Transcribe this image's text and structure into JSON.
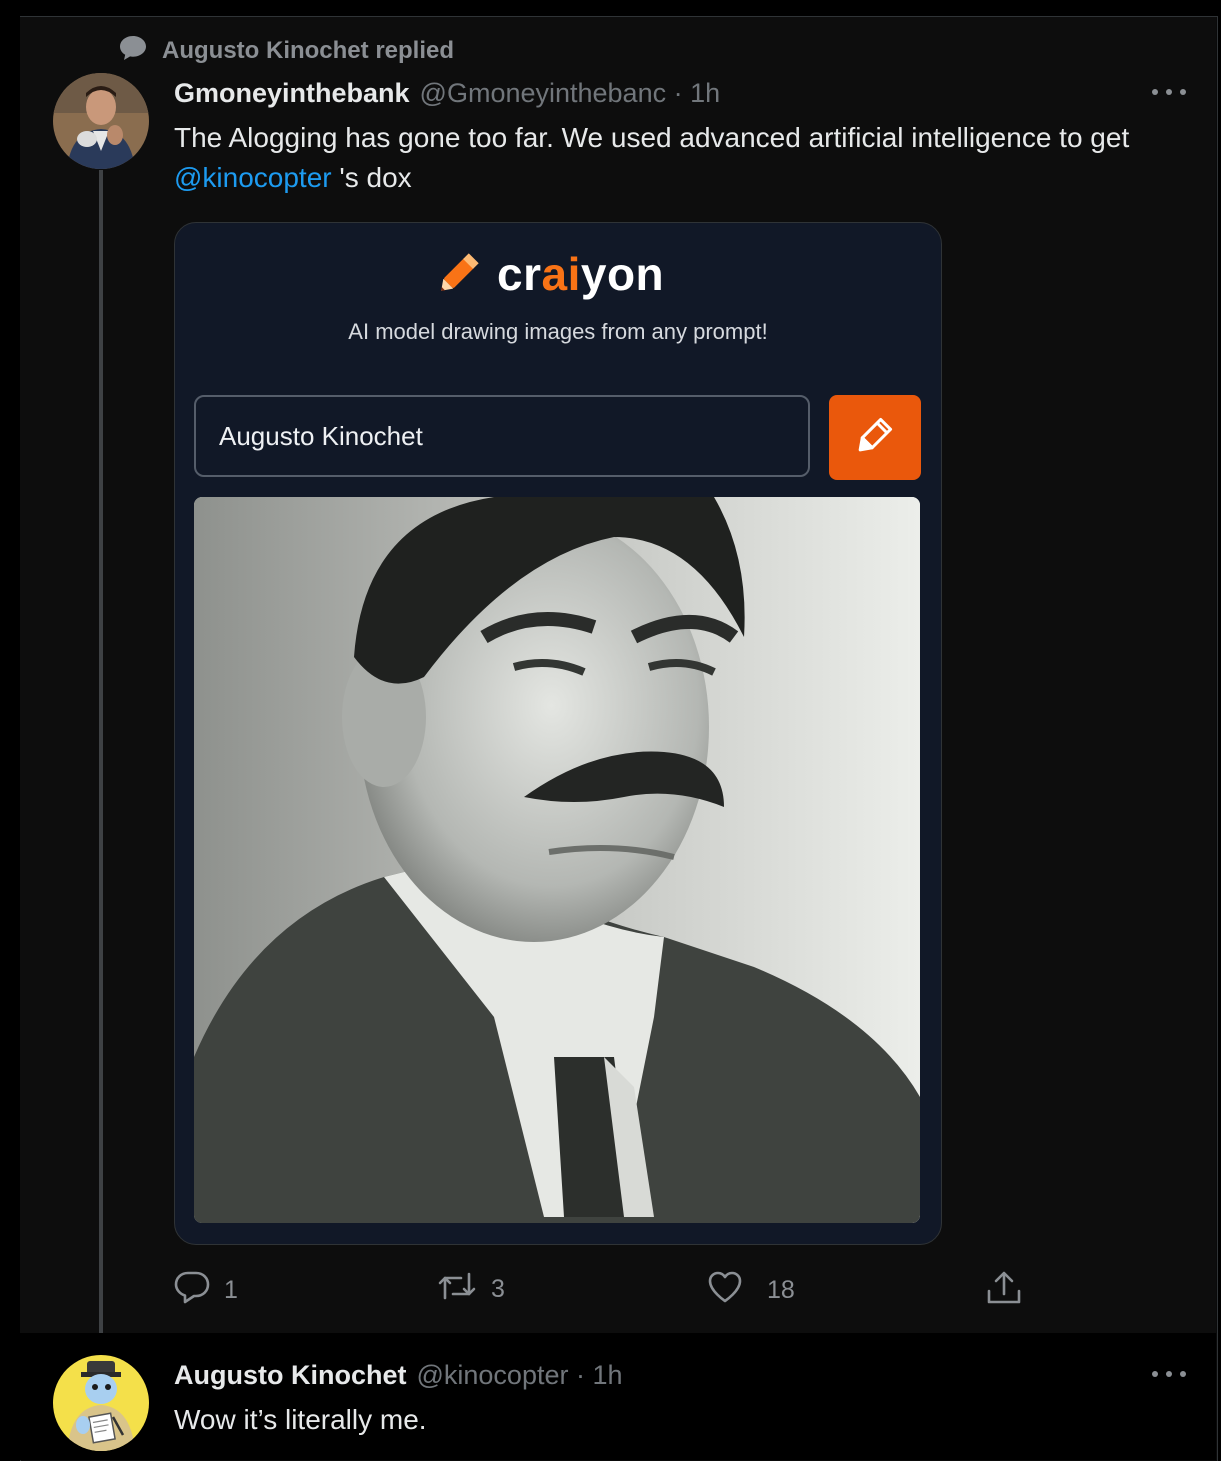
{
  "reply_context": {
    "text": "Augusto Kinochet replied"
  },
  "tweet1": {
    "display_name": "Gmoneyinthebank",
    "handle_time": "@Gmoneyinthebanc · 1h",
    "text_before": "The Alogging has gone too far.  We used advanced artificial intelligence to get ",
    "mention": "@kinocopter",
    "text_after": " 's dox",
    "card": {
      "brand_cr": "cr",
      "brand_ai": "ai",
      "brand_yon": "yon",
      "tagline": "AI model drawing images from any prompt!",
      "prompt_value": "Augusto Kinochet",
      "accent": "#ea580c"
    },
    "reply_count": "1",
    "retweet_count": "3",
    "like_count": "18"
  },
  "tweet2": {
    "display_name": "Augusto Kinochet",
    "handle_time": "@kinocopter · 1h",
    "text": "Wow it’s literally me."
  },
  "colors": {
    "link": "#1d9bf0",
    "muted": "#71767b",
    "brand_orange": "#f97316"
  }
}
